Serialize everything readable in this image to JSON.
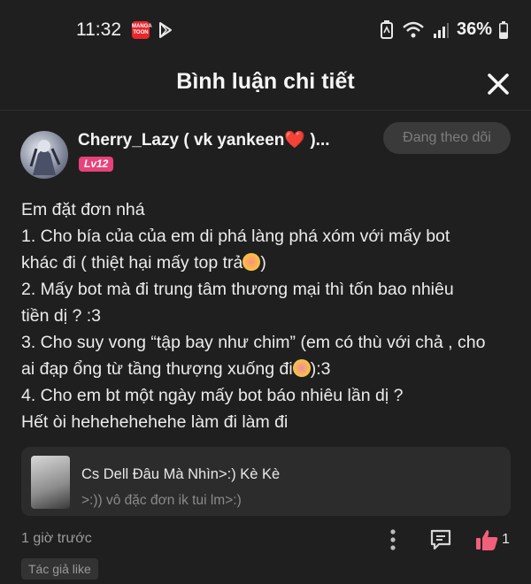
{
  "status_bar": {
    "time": "11:32",
    "battery": "36%",
    "app_badge": "MANGA TOON"
  },
  "header": {
    "title": "Bình luận chi tiết"
  },
  "comment": {
    "username": "Cherry_Lazy ( vk yankeen❤️ )...",
    "level": "Lv12",
    "follow_label": "Đang theo dõi",
    "lines": [
      "Em đặt đơn nhá",
      "1.  Cho bía của của em di phá làng phá xóm với mấy bot",
      "khác đi ( thiệt hại mấy top trả",
      "2. Mấy bot mà đi trung tâm thương mại thì tốn bao nhiêu",
      "tiền dị ? :3",
      "3. Cho suy vong “tập bay như chim” (em có thù với chả , cho",
      "ai đạp ổng từ tầng thượng xuống đi",
      "4. Cho em bt một ngày mấy bot báo nhiêu lần dị ?",
      "Hết òi hehehehehehe làm đi làm đi"
    ],
    "line3_tail": ")",
    "line7_tail": "):3",
    "time_ago": "1 giờ trước",
    "like_count": "1",
    "author_like": "Tác giả like"
  },
  "reply_preview": {
    "name": "Cs Dell Đâu Mà Nhìn>:) Kè Kè",
    "text": ">:)) vô đặc đơn ik tui lm>:)"
  },
  "colors": {
    "background": "#1f1f1f",
    "level_badge": "#e7427a",
    "like": "#f0607a"
  }
}
